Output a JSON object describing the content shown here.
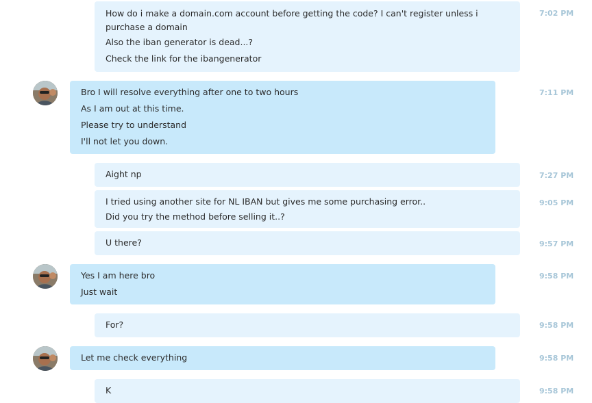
{
  "messages": [
    {
      "dir": "out",
      "time": "7:02 PM",
      "lines": [
        "How do i make a domain.com account before getting the code? I can't register unless i purchase a domain",
        "Also the iban generator is dead...?",
        "Check the link for the ibangenerator"
      ]
    },
    {
      "dir": "in",
      "time": "7:11 PM",
      "lines": [
        "Bro I will resolve everything after one to two hours",
        "As I am out at this time.",
        "Please try to understand",
        "I'll not let you down."
      ]
    },
    {
      "dir": "out",
      "time": "7:27 PM",
      "lines": [
        "Aight np"
      ]
    },
    {
      "dir": "out",
      "time": "9:05 PM",
      "lines": [
        "I tried using another site for NL IBAN but gives me some purchasing error..",
        "Did you try the method before selling it..?"
      ]
    },
    {
      "dir": "out",
      "time": "9:57 PM",
      "lines": [
        "U there?"
      ]
    },
    {
      "dir": "in",
      "time": "9:58 PM",
      "lines": [
        "Yes I am here bro",
        "Just wait"
      ]
    },
    {
      "dir": "out",
      "time": "9:58 PM",
      "lines": [
        "For?"
      ]
    },
    {
      "dir": "in",
      "time": "9:58 PM",
      "lines": [
        "Let me check everything"
      ]
    },
    {
      "dir": "out",
      "time": "9:58 PM",
      "lines": [
        "K"
      ]
    }
  ],
  "colors": {
    "outgoing_bubble": "#e5f3fd",
    "incoming_bubble": "#c8e9fb",
    "timestamp": "#a7c6d8",
    "text": "#2b2b2b"
  },
  "icons": {
    "contact_avatar": "avatar-photo"
  }
}
